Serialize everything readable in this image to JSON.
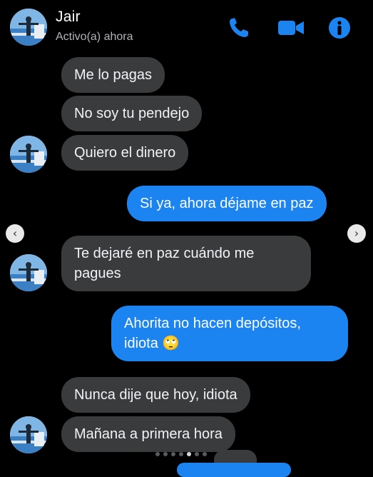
{
  "header": {
    "contact_name": "Jair",
    "status": "Activo(a) ahora",
    "icons": {
      "call": "phone-icon",
      "video": "video-camera-icon",
      "info": "info-icon"
    },
    "accent_color": "#1b84f1"
  },
  "messages": [
    {
      "from": "them",
      "text": "Me lo pagas"
    },
    {
      "from": "them",
      "text": "No soy tu pendejo"
    },
    {
      "from": "them",
      "text": "Quiero el dinero"
    },
    {
      "from": "me",
      "text": "Si ya, ahora déjame en paz"
    },
    {
      "from": "them",
      "text_line1": "Te dejaré en paz cuándo me",
      "text_line2": "pagues"
    },
    {
      "from": "me",
      "text_line1": "Ahorita no hacen depósitos,",
      "text_line2": "idiota",
      "emoji": "🙄"
    },
    {
      "from": "them",
      "text": "Nunca dije que hoy, idiota"
    },
    {
      "from": "them",
      "text": "Mañana a primera hora"
    }
  ],
  "carousel": {
    "prev_glyph": "‹",
    "next_glyph": "›",
    "dot_count": 7,
    "active_dot": 4
  },
  "colors": {
    "background": "#000000",
    "incoming_bubble": "#3a3b3c",
    "outgoing_bubble": "#1b84f1"
  }
}
